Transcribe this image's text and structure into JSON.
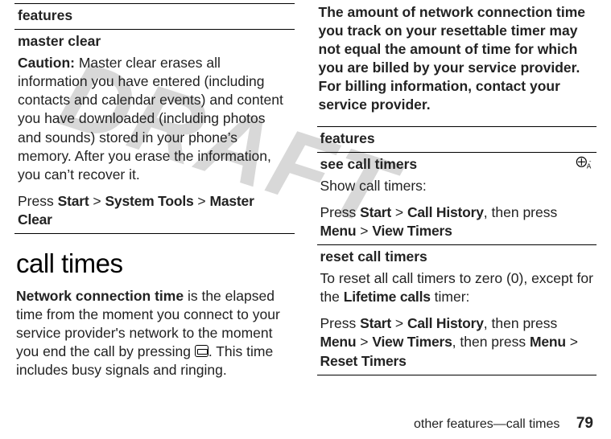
{
  "watermark": "DRAFT",
  "left": {
    "features_header": "features",
    "master_clear_title": "master clear",
    "caution_label": "Caution:",
    "caution_body": " Master clear erases all information you have entered (including contacts and calendar events) and content you have downloaded (including photos and sounds) stored in your phone’s memory. After you erase the information, you can’t recover it.",
    "press_label": "Press ",
    "start": "Start",
    "gt1": " > ",
    "system_tools": "System Tools",
    "gt2": " > ",
    "master_clear": "Master Clear",
    "section_heading": "call times",
    "net_bold": "Network connection time",
    "net_body": " is the elapsed time from the moment you connect to your service provider's network to the moment you end the call by pressing ",
    "net_tail": ". This time includes busy signals and ringing."
  },
  "right": {
    "disclaimer": "The amount of network connection time you track on your resettable timer may not equal the amount of time for which you are billed by your service provider. For billing information, contact your service provider.",
    "features_header": "features",
    "see_title": "see call timers",
    "see_body": "Show call timers:",
    "see_press": "Press ",
    "see_start": "Start",
    "see_gt1": " > ",
    "see_ch": "Call History",
    "see_then": ", then press ",
    "see_menu": "Menu",
    "see_gt2": " > ",
    "see_vt": "View Timers",
    "reset_title": "reset call timers",
    "reset_body_a": "To reset all call timers to zero (0), except for the ",
    "reset_lifetime": "Lifetime calls",
    "reset_body_b": " timer:",
    "reset_press": "Press ",
    "reset_start": "Start",
    "reset_gt1": " > ",
    "reset_ch": "Call History",
    "reset_then1": ", then press ",
    "reset_menu1": "Menu",
    "reset_gt2": " > ",
    "reset_vt": "View Timers",
    "reset_then2": ", then press ",
    "reset_menu2": "Menu",
    "reset_gt3": " > ",
    "reset_rt": "Reset Timers"
  },
  "footer": {
    "section": "other features—call times",
    "page": "79"
  }
}
